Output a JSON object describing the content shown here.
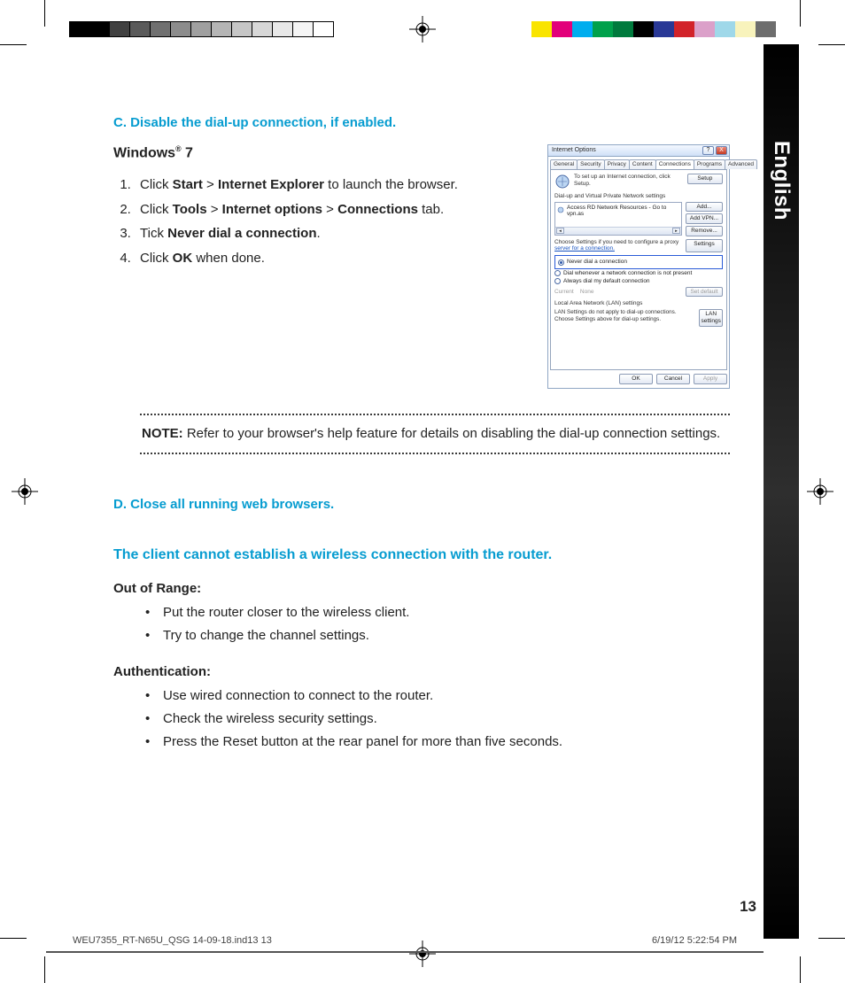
{
  "language_tab": "English",
  "page_number": "13",
  "footer": {
    "file": "WEU7355_RT-N65U_QSG 14-09-18.ind13   13",
    "stamp": "6/19/12   5:22:54 PM"
  },
  "section_c": {
    "heading": "C.   Disable the dial-up connection, if enabled."
  },
  "win7": {
    "title_a": "Windows",
    "title_reg": "®",
    "title_b": " 7",
    "step1_a": "Click ",
    "step1_b": "Start",
    "step1_c": " > ",
    "step1_d": "Internet Explorer",
    "step1_e": " to launch the browser.",
    "step2_a": "Click ",
    "step2_b": "Tools",
    "step2_c": " > ",
    "step2_d": "Internet options",
    "step2_e": " > ",
    "step2_f": "Connections",
    "step2_g": " tab.",
    "step3_a": "Tick ",
    "step3_b": "Never dial a connection",
    "step3_c": ".",
    "step4_a": "Click ",
    "step4_b": "OK",
    "step4_c": " when done."
  },
  "dialog": {
    "title": "Internet Options",
    "help_btn": "?",
    "close_btn": "X",
    "tabs": {
      "general": "General",
      "security": "Security",
      "privacy": "Privacy",
      "content": "Content",
      "connections": "Connections",
      "programs": "Programs",
      "advanced": "Advanced"
    },
    "setup_text": "To set up an Internet connection, click Setup.",
    "setup_btn": "Setup",
    "group1": "Dial-up and Virtual Private Network settings",
    "list_item": "Access RD Network Resources - Go to vpn.as",
    "add_btn": "Add...",
    "addvpn_btn": "Add VPN...",
    "remove_btn": "Remove...",
    "proxy_a": "Choose Settings if you need to configure a proxy ",
    "proxy_b": "server for a connection.",
    "settings_btn": "Settings",
    "radio_never": "Never dial a connection",
    "radio_when": "Dial whenever a network connection is not present",
    "radio_always": "Always dial my default connection",
    "current_lbl": "Current",
    "current_val": "None",
    "setdefault_btn": "Set default",
    "lan_group": "Local Area Network (LAN) settings",
    "lan_text": "LAN Settings do not apply to dial-up connections. Choose Settings above for dial-up settings.",
    "lan_btn": "LAN settings",
    "ok": "OK",
    "cancel": "Cancel",
    "apply": "Apply"
  },
  "note": {
    "label": "NOTE:",
    "text": "  Refer to your browser's help feature for details on disabling the dial-up connection settings."
  },
  "section_d": {
    "heading": "D.   Close all running web browsers."
  },
  "trouble_title": "The client cannot establish a wireless connection with the router.",
  "range": {
    "title": "Out of Range:",
    "b1": "Put the router closer to the wireless client.",
    "b2": "Try to change the channel settings."
  },
  "auth": {
    "title": "Authentication:",
    "b1": "Use wired connection to connect to the router.",
    "b2": "Check the wireless security settings.",
    "b3": "Press the Reset button at the rear panel for more than five seconds."
  }
}
